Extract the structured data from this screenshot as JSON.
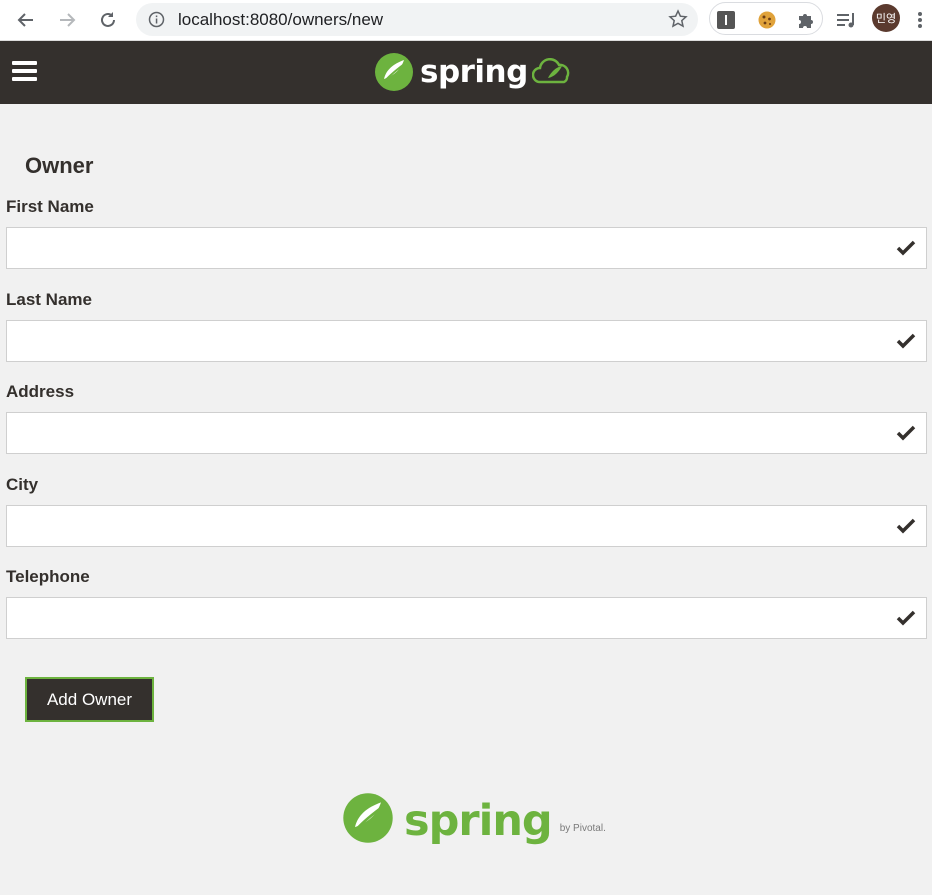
{
  "browser": {
    "url": "localhost:8080/owners/new",
    "avatar_label": "민영"
  },
  "navbar": {
    "brand": "spring"
  },
  "form": {
    "title": "Owner",
    "fields": [
      {
        "label": "First Name",
        "value": ""
      },
      {
        "label": "Last Name",
        "value": ""
      },
      {
        "label": "Address",
        "value": ""
      },
      {
        "label": "City",
        "value": ""
      },
      {
        "label": "Telephone",
        "value": ""
      }
    ],
    "submit_label": "Add Owner"
  },
  "footer": {
    "brand": "spring",
    "by_label": "by Pivotal."
  },
  "colors": {
    "spring_green": "#6db33f",
    "dark_brown": "#34302d",
    "background": "#f1f1f1"
  }
}
